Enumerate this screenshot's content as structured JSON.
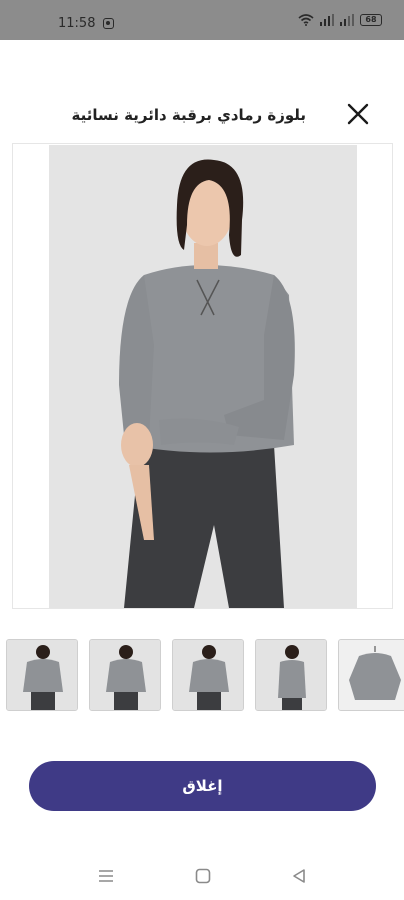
{
  "status_bar": {
    "time": "11:58",
    "battery": "68",
    "icons": [
      "message-icon",
      "wifi-icon",
      "signal-icon",
      "signal-icon",
      "battery-icon"
    ]
  },
  "header": {
    "title": "بلوزة رمادي برقبة دائرية نسائية",
    "close_icon": "close-icon"
  },
  "gallery": {
    "thumbnails": [
      "front-view",
      "front-view-2",
      "front-view-3",
      "back-view",
      "flat-lay-on-hanger"
    ]
  },
  "footer": {
    "close_label": "إغلاق"
  },
  "nav": {
    "items": [
      "recent-apps-icon",
      "home-icon",
      "back-icon"
    ]
  },
  "colors": {
    "accent": "#3f3a86",
    "status_bar": "#8c8c8c",
    "sweater": "#8f9296",
    "jeans": "#3c3d40"
  }
}
